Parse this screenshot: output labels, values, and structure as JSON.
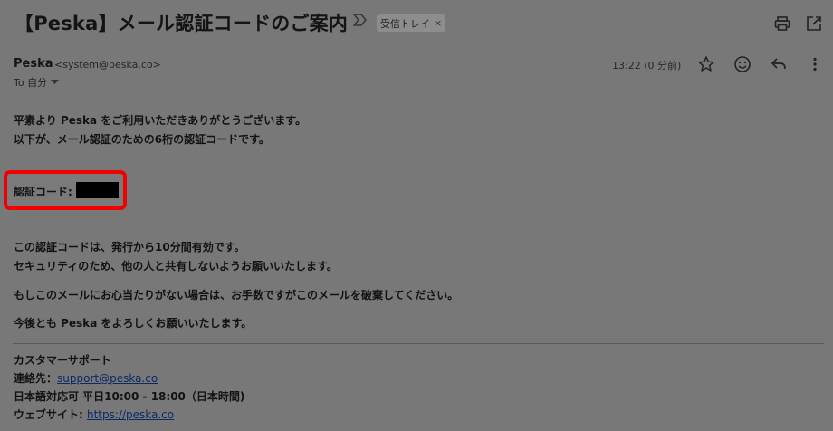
{
  "header": {
    "subject": "【Peska】メール認証コードのご案内",
    "label": "受信トレイ",
    "label_remove": "×",
    "icons": {
      "important": "important-marker-icon",
      "print": "print-icon",
      "open_new": "open-in-new-window-icon"
    }
  },
  "sender": {
    "name": "Peska",
    "email": "<system@peska.co>",
    "to_label": "To 自分",
    "timestamp": "13:22 (0 分前)",
    "icons": [
      "star-icon",
      "emoji-icon",
      "reply-icon",
      "more-vert-icon"
    ]
  },
  "body": {
    "greeting1": "平素より Peska をご利用いただきありがとうございます。",
    "greeting2": "以下が、メール認証のための6桁の認証コードです。",
    "code_label": "認証コード:",
    "validity1": "この認証コードは、発行から10分間有効です。",
    "validity2": "セキュリティのため、他の人と共有しないようお願いいたします。",
    "notice": "もしこのメールにお心当たりがない場合は、お手数ですがこのメールを破棄してください。",
    "closing": "今後とも Peska をよろしくお願いいたします。"
  },
  "signature": {
    "title": "カスタマーサポート",
    "contact_label": "連絡先：",
    "contact_email": "support@peska.co",
    "hours": "日本語対応可 平日10:00 - 18:00（日本時間)",
    "website_label": "ウェブサイト: ",
    "website_url": "https://peska.co"
  },
  "colors": {
    "background": "#787878",
    "highlight": "#f00000",
    "link": "#0c2a66"
  }
}
